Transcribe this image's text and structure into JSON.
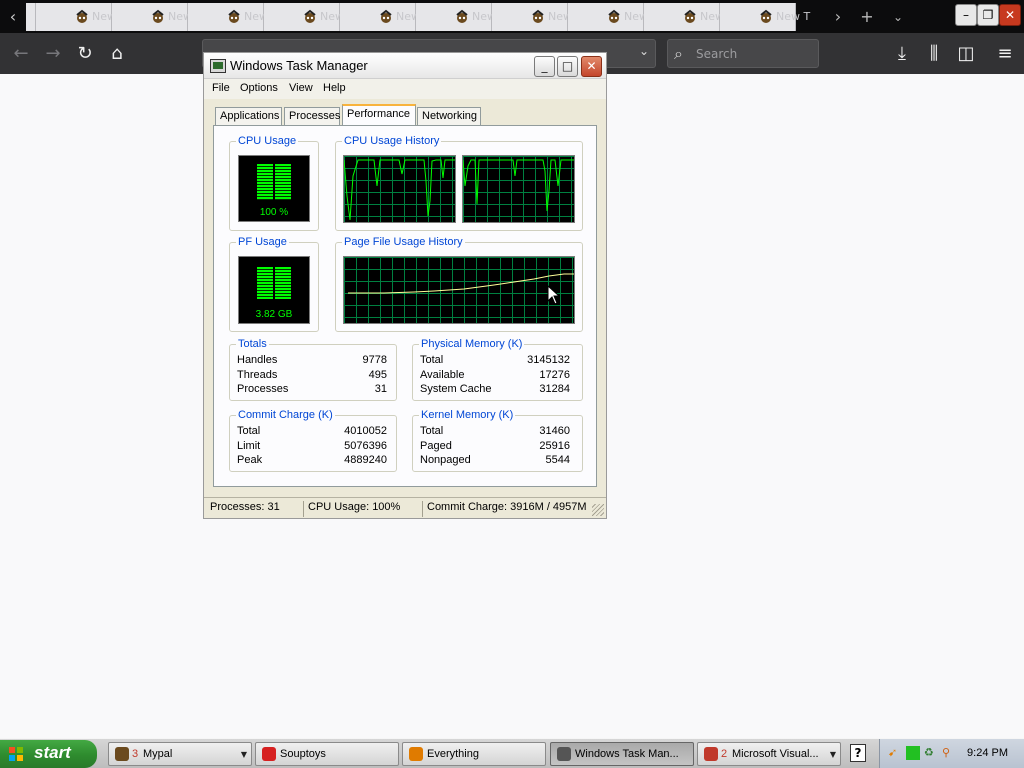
{
  "browser": {
    "tabs": [
      {
        "label": "New T"
      },
      {
        "label": "New T"
      },
      {
        "label": "New T"
      },
      {
        "label": "New T"
      },
      {
        "label": "New T"
      },
      {
        "label": "New T"
      },
      {
        "label": "New T"
      },
      {
        "label": "New T"
      },
      {
        "label": "New T"
      },
      {
        "label": "New T"
      }
    ],
    "search_placeholder": "Search"
  },
  "taskmgr": {
    "title": "Windows Task Manager",
    "menu": [
      "File",
      "Options",
      "View",
      "Help"
    ],
    "tabs": [
      "Applications",
      "Processes",
      "Performance",
      "Networking"
    ],
    "active_tab": "Performance",
    "cpu_usage_label": "CPU Usage",
    "cpu_usage_value": "100 %",
    "cpu_usage_percent": 100,
    "cpu_history_label": "CPU Usage History",
    "pf_usage_label": "PF Usage",
    "pf_usage_value": "3.82 GB",
    "pf_history_label": "Page File Usage History",
    "totals": {
      "label": "Totals",
      "rows": [
        {
          "name": "Handles",
          "value": "9778"
        },
        {
          "name": "Threads",
          "value": "495"
        },
        {
          "name": "Processes",
          "value": "31"
        }
      ]
    },
    "physical_memory": {
      "label": "Physical Memory (K)",
      "rows": [
        {
          "name": "Total",
          "value": "3145132"
        },
        {
          "name": "Available",
          "value": "17276"
        },
        {
          "name": "System Cache",
          "value": "31284"
        }
      ]
    },
    "commit_charge": {
      "label": "Commit Charge (K)",
      "rows": [
        {
          "name": "Total",
          "value": "4010052"
        },
        {
          "name": "Limit",
          "value": "5076396"
        },
        {
          "name": "Peak",
          "value": "4889240"
        }
      ]
    },
    "kernel_memory": {
      "label": "Kernel Memory (K)",
      "rows": [
        {
          "name": "Total",
          "value": "31460"
        },
        {
          "name": "Paged",
          "value": "25916"
        },
        {
          "name": "Nonpaged",
          "value": "5544"
        }
      ]
    },
    "status": {
      "processes": "Processes: 31",
      "cpu": "CPU Usage: 100%",
      "commit": "Commit Charge: 3916M / 4957M"
    }
  },
  "taskbar": {
    "start_label": "start",
    "tasks": [
      {
        "count": "3",
        "label": "Mypal",
        "dropdown": true,
        "icon": "mypal-icon"
      },
      {
        "count": "",
        "label": "Souptoys",
        "dropdown": false,
        "icon": "souptoys-icon"
      },
      {
        "count": "",
        "label": "Everything",
        "dropdown": false,
        "icon": "everything-icon"
      },
      {
        "count": "",
        "label": "Windows Task Man...",
        "dropdown": false,
        "icon": "taskmgr-icon",
        "active": true
      },
      {
        "count": "2",
        "label": "Microsoft Visual...",
        "dropdown": true,
        "icon": "visual-studio-icon"
      }
    ],
    "clock": "9:24 PM"
  },
  "colors": {
    "meter_green": "#00ff00",
    "grid_green": "#008040",
    "pf_line": "#ffff99",
    "group_label_blue": "#0046d5",
    "start_green": "#2e8b2e"
  }
}
